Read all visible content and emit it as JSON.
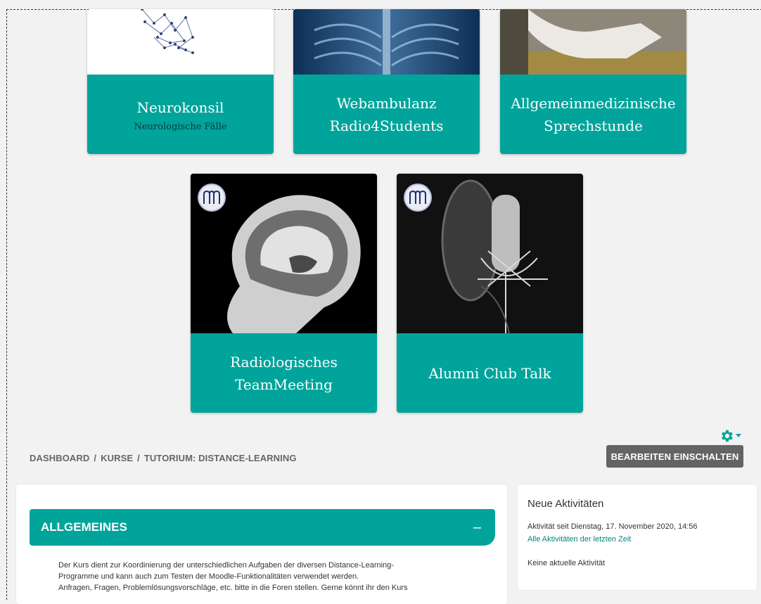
{
  "tiles": [
    {
      "title": "Neurokonsil",
      "subtitle": "Neurologische Fälle"
    },
    {
      "title_line1": "Webambulanz",
      "title_line2": "Radio4Students"
    },
    {
      "title_line1": "Allgemeinmedizinische",
      "title_line2": "Sprechstunde"
    },
    {
      "title_line1": "Radiologisches",
      "title_line2": "TeamMeeting"
    },
    {
      "title": "Alumni Club Talk"
    }
  ],
  "breadcrumb": {
    "items": [
      "DASHBOARD",
      "KURSE",
      "TUTORIUM: DISTANCE-LEARNING"
    ],
    "separator": "/"
  },
  "toolbar": {
    "edit_label": "BEARBEITEN EINSCHALTEN",
    "gear_icon": "gear-icon"
  },
  "section": {
    "title": "ALLGEMEINES",
    "collapse_symbol": "–",
    "summary_lines": [
      "Der Kurs dient zur Koordinierung der unterschiedlichen Aufgaben der diversen Distance-Learning-",
      "Programme und kann auch zum Testen der Moodle-Funktionalitäten verwendet werden.",
      "Anfragen, Fragen, Problemlösungsvorschläge, etc. bitte in die Foren stellen. Gerne könnt ihr den Kurs"
    ]
  },
  "activities": {
    "title": "Neue Aktivitäten",
    "since": "Aktivität seit Dienstag, 17. November 2020, 14:56",
    "all_link": "Alle Aktivitäten der letzten Zeit",
    "none": "Keine aktuelle Aktivität"
  },
  "colors": {
    "accent": "#00a49b",
    "button": "#646464",
    "link": "#00857e"
  }
}
